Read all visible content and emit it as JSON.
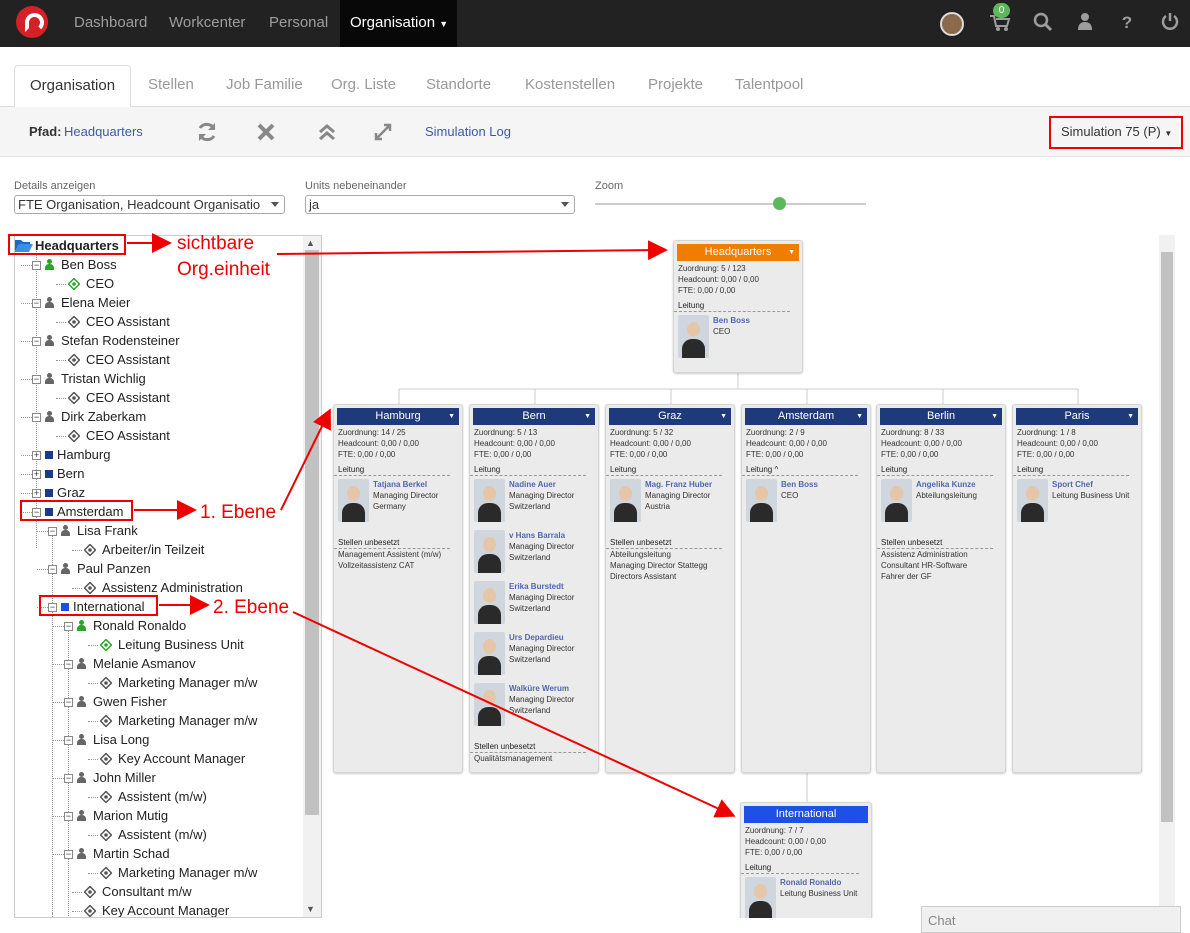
{
  "topnav": {
    "items": [
      "Dashboard",
      "Workcenter",
      "Personal",
      "Organisation"
    ],
    "cart_badge": "0"
  },
  "tabs": [
    "Organisation",
    "Stellen",
    "Job Familie",
    "Org. Liste",
    "Standorte",
    "Kostenstellen",
    "Projekte",
    "Talentpool"
  ],
  "toolbar": {
    "path_label": "Pfad:",
    "path_value": "Headquarters",
    "sim_log": "Simulation Log",
    "simulation": "Simulation 75 (P)"
  },
  "controls": {
    "details_label": "Details anzeigen",
    "details_value": "FTE Organisation, Headcount Organisatio",
    "units_label": "Units nebeneinander",
    "units_value": "ja",
    "zoom_label": "Zoom",
    "zoom_level": 0.68
  },
  "tree": [
    {
      "t": "Headquarters",
      "k": "root"
    },
    {
      "t": "Ben Boss",
      "k": "person",
      "lead": true
    },
    {
      "t": "CEO",
      "k": "pos",
      "lead": true
    },
    {
      "t": "Elena Meier",
      "k": "person"
    },
    {
      "t": "CEO Assistant",
      "k": "pos"
    },
    {
      "t": "Stefan Rodensteiner",
      "k": "person"
    },
    {
      "t": "CEO Assistant",
      "k": "pos"
    },
    {
      "t": "Tristan Wichlig",
      "k": "person"
    },
    {
      "t": "CEO Assistant",
      "k": "pos"
    },
    {
      "t": "Dirk Zaberkam",
      "k": "person"
    },
    {
      "t": "CEO Assistant",
      "k": "pos"
    },
    {
      "t": "Hamburg",
      "k": "unit",
      "tog": "+"
    },
    {
      "t": "Bern",
      "k": "unit",
      "tog": "+"
    },
    {
      "t": "Graz",
      "k": "unit",
      "tog": "+"
    },
    {
      "t": "Amsterdam",
      "k": "unit",
      "tog": "−"
    },
    {
      "t": "Lisa Frank",
      "k": "person",
      "lvl": 1
    },
    {
      "t": "Arbeiter/in Teilzeit",
      "k": "pos",
      "lvl": 1
    },
    {
      "t": "Paul Panzen",
      "k": "person",
      "lvl": 1
    },
    {
      "t": "Assistenz Administration",
      "k": "pos",
      "lvl": 1
    },
    {
      "t": "International",
      "k": "unit",
      "tog": "−",
      "lvl": 1,
      "blue": true
    },
    {
      "t": "Ronald Ronaldo",
      "k": "person",
      "lvl": 2,
      "lead": true
    },
    {
      "t": "Leitung Business Unit",
      "k": "pos",
      "lvl": 2,
      "lead": true
    },
    {
      "t": "Melanie Asmanov",
      "k": "person",
      "lvl": 2
    },
    {
      "t": "Marketing Manager m/w",
      "k": "pos",
      "lvl": 2
    },
    {
      "t": "Gwen Fisher",
      "k": "person",
      "lvl": 2
    },
    {
      "t": "Marketing Manager m/w",
      "k": "pos",
      "lvl": 2
    },
    {
      "t": "Lisa Long",
      "k": "person",
      "lvl": 2
    },
    {
      "t": "Key Account Manager",
      "k": "pos",
      "lvl": 2
    },
    {
      "t": "John Miller",
      "k": "person",
      "lvl": 2
    },
    {
      "t": "Assistent (m/w)",
      "k": "pos",
      "lvl": 2
    },
    {
      "t": "Marion Mutig",
      "k": "person",
      "lvl": 2
    },
    {
      "t": "Assistent (m/w)",
      "k": "pos",
      "lvl": 2
    },
    {
      "t": "Martin Schad",
      "k": "person",
      "lvl": 2
    },
    {
      "t": "Marketing Manager m/w",
      "k": "pos",
      "lvl": 2
    },
    {
      "t": "Consultant m/w",
      "k": "pos",
      "lvl": 1
    },
    {
      "t": "Key Account Manager",
      "k": "pos",
      "lvl": 1
    }
  ],
  "chart": {
    "hq": {
      "name": "Headquarters",
      "zuordnung": "Zuordnung: 5 / 123",
      "headcount": "Headcount: 0,00 / 0,00",
      "fte": "FTE: 0,00 / 0,00",
      "leitung": "Leitung",
      "managers": [
        {
          "n": "Ben Boss",
          "r": [
            "CEO"
          ]
        }
      ]
    },
    "units": [
      {
        "name": "Hamburg",
        "zuordnung": "Zuordnung: 14 / 25",
        "headcount": "Headcount: 0,00 / 0,00",
        "fte": "FTE: 0,00 / 0,00",
        "leitung": "Leitung",
        "managers": [
          {
            "n": "Tatjana Berkel",
            "r": [
              "Managing Director",
              "Germany"
            ]
          }
        ],
        "vacant_label": "Stellen unbesetzt",
        "vacant": [
          "Management Assistent (m/w)",
          "Vollzeitassistenz CAT"
        ]
      },
      {
        "name": "Bern",
        "zuordnung": "Zuordnung: 5 / 13",
        "headcount": "Headcount: 0,00 / 0,00",
        "fte": "FTE: 0,00 / 0,00",
        "leitung": "Leitung",
        "managers": [
          {
            "n": "Nadine Auer",
            "r": [
              "Managing Director",
              "Switzerland"
            ]
          },
          {
            "n": "v Hans Barrala",
            "r": [
              "Managing Director",
              "Switzerland"
            ]
          },
          {
            "n": "Erika Burstedt",
            "r": [
              "Managing Director",
              "Switzerland"
            ]
          },
          {
            "n": "Urs Depardieu",
            "r": [
              "Managing Director",
              "Switzerland"
            ]
          },
          {
            "n": "Walküre Werum",
            "r": [
              "Managing Director",
              "Switzerland"
            ]
          }
        ],
        "vacant_label": "Stellen unbesetzt",
        "vacant": [
          "Qualitätsmanagement"
        ]
      },
      {
        "name": "Graz",
        "zuordnung": "Zuordnung: 5 / 32",
        "headcount": "Headcount: 0,00 / 0,00",
        "fte": "FTE: 0,00 / 0,00",
        "leitung": "Leitung",
        "managers": [
          {
            "n": "Mag. Franz Huber",
            "r": [
              "Managing Director",
              "Austria"
            ]
          }
        ],
        "vacant_label": "Stellen unbesetzt",
        "vacant": [
          "Abteilungsleitung",
          "Managing Director Stattegg",
          "Directors Assistant"
        ]
      },
      {
        "name": "Amsterdam",
        "zuordnung": "Zuordnung: 2 / 9",
        "headcount": "Headcount: 0,00 / 0,00",
        "fte": "FTE: 0,00 / 0,00",
        "leitung": "Leitung ^",
        "managers": [
          {
            "n": "Ben Boss",
            "r": [
              "CEO"
            ]
          }
        ],
        "vacant_label": "",
        "vacant": []
      },
      {
        "name": "Berlin",
        "zuordnung": "Zuordnung: 8 / 33",
        "headcount": "Headcount: 0,00 / 0,00",
        "fte": "FTE: 0,00 / 0,00",
        "leitung": "Leitung",
        "managers": [
          {
            "n": "Angelika Kunze",
            "r": [
              "Abteilungsleitung"
            ]
          }
        ],
        "vacant_label": "Stellen unbesetzt",
        "vacant": [
          "Assistenz Administration",
          "Consultant HR-Software",
          "Fahrer der GF"
        ]
      },
      {
        "name": "Paris",
        "zuordnung": "Zuordnung: 1 / 8",
        "headcount": "Headcount: 0,00 / 0,00",
        "fte": "FTE: 0,00 / 0,00",
        "leitung": "Leitung",
        "managers": [
          {
            "n": "Sport Chef",
            "r": [
              "Leitung Business Unit"
            ]
          }
        ],
        "vacant_label": "",
        "vacant": []
      }
    ],
    "international": {
      "name": "International",
      "zuordnung": "Zuordnung: 7 / 7",
      "headcount": "Headcount: 0,00 / 0,00",
      "fte": "FTE: 0,00 / 0,00",
      "leitung": "Leitung",
      "managers": [
        {
          "n": "Ronald Ronaldo",
          "r": [
            "Leitung Business Unit"
          ]
        }
      ]
    }
  },
  "annotations": {
    "visible_a": "sichtbare",
    "visible_b": "Org.einheit",
    "level1": "1. Ebene",
    "level2": "2. Ebene"
  },
  "chat": "Chat",
  "colors": {
    "hq_header": "#f07d00",
    "unit_header": "#1f3a7a",
    "intl_header": "#1e4fe6",
    "lead_green": "#2aa52a",
    "link": "#4f67b0",
    "annotation": "#e00000"
  }
}
